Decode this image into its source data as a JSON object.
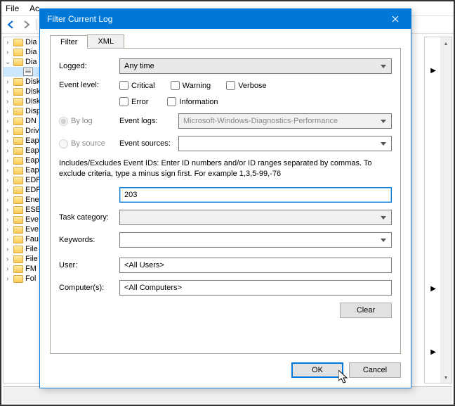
{
  "menubar": {
    "file": "File",
    "action": "Ac"
  },
  "tree": {
    "items": [
      {
        "label": "Dia",
        "icon": "folder",
        "expand": true
      },
      {
        "label": "Dia",
        "icon": "folder",
        "expand": true
      },
      {
        "label": "Dia",
        "icon": "folder",
        "expanded": true
      },
      {
        "label": "",
        "icon": "log",
        "selected": true,
        "indent": true
      },
      {
        "label": "Disk",
        "icon": "folder",
        "expand": true
      },
      {
        "label": "Disk",
        "icon": "folder",
        "expand": true
      },
      {
        "label": "Disk",
        "icon": "folder",
        "expand": true
      },
      {
        "label": "Disp",
        "icon": "folder",
        "expand": true
      },
      {
        "label": "DN",
        "icon": "folder",
        "expand": true
      },
      {
        "label": "Driv",
        "icon": "folder",
        "expand": true
      },
      {
        "label": "Eap",
        "icon": "folder",
        "expand": true
      },
      {
        "label": "Eap",
        "icon": "folder",
        "expand": true
      },
      {
        "label": "Eap",
        "icon": "folder",
        "expand": true
      },
      {
        "label": "Eap",
        "icon": "folder",
        "expand": true
      },
      {
        "label": "EDP",
        "icon": "folder",
        "expand": true
      },
      {
        "label": "EDP",
        "icon": "folder",
        "expand": true
      },
      {
        "label": "Ene",
        "icon": "folder",
        "expand": true
      },
      {
        "label": "ESE",
        "icon": "folder",
        "expand": true
      },
      {
        "label": "Eve",
        "icon": "folder",
        "expand": true
      },
      {
        "label": "Eve",
        "icon": "folder",
        "expand": true
      },
      {
        "label": "Fau",
        "icon": "folder",
        "expand": true
      },
      {
        "label": "File",
        "icon": "folder",
        "expand": true
      },
      {
        "label": "File",
        "icon": "folder",
        "expand": true
      },
      {
        "label": "FM",
        "icon": "folder",
        "expand": true
      },
      {
        "label": "Fol",
        "icon": "folder",
        "expand": true
      }
    ]
  },
  "dialog": {
    "title": "Filter Current Log",
    "tabs": {
      "filter": "Filter",
      "xml": "XML"
    },
    "labels": {
      "logged": "Logged:",
      "event_level": "Event level:",
      "by_log": "By log",
      "by_source": "By source",
      "event_logs": "Event logs:",
      "event_sources": "Event sources:",
      "task_category": "Task category:",
      "keywords": "Keywords:",
      "user": "User:",
      "computers": "Computer(s):"
    },
    "values": {
      "logged": "Any time",
      "event_logs": "Microsoft-Windows-Diagnostics-Performance",
      "event_sources": "",
      "event_ids": "203",
      "task_category": "",
      "keywords": "",
      "user": "<All Users>",
      "computers": "<All Computers>"
    },
    "checkboxes": {
      "critical": "Critical",
      "warning": "Warning",
      "verbose": "Verbose",
      "error": "Error",
      "information": "Information"
    },
    "helptext": "Includes/Excludes Event IDs: Enter ID numbers and/or ID ranges separated by commas. To exclude criteria, type a minus sign first. For example 1,3,5-99,-76",
    "buttons": {
      "clear": "Clear",
      "ok": "OK",
      "cancel": "Cancel"
    }
  }
}
